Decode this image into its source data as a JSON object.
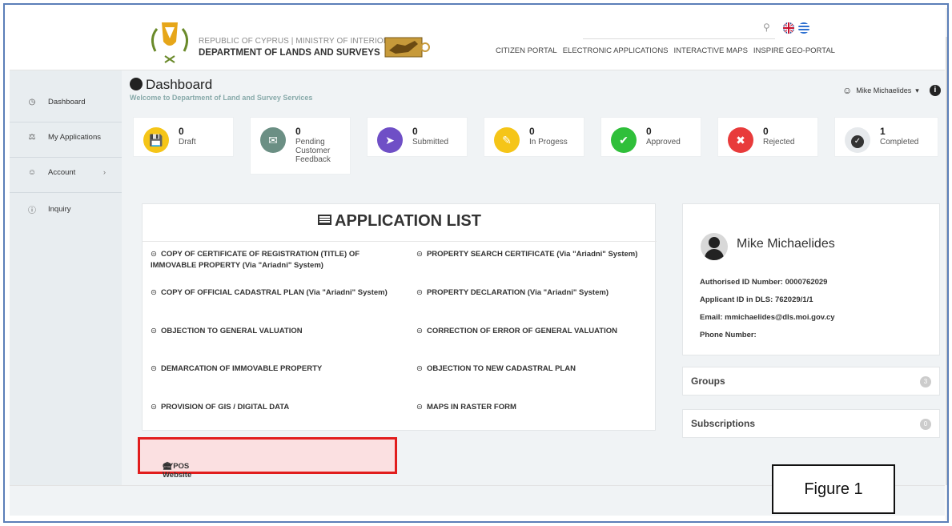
{
  "header": {
    "org_line1": "REPUBLIC OF CYPRUS | MINISTRY OF INTERIOR",
    "org_line2": "DEPARTMENT OF LANDS AND SURVEYS",
    "nav": [
      "CITIZEN PORTAL",
      "ELECTRONIC APPLICATIONS",
      "INTERACTIVE MAPS",
      "INSPIRE GEO-PORTAL"
    ],
    "icons": {
      "search": "search-icon",
      "flag_en": "uk-flag-icon",
      "flag_el": "greece-flag-icon"
    }
  },
  "sidebar": {
    "items": [
      {
        "label": "Dashboard",
        "icon": "clock-icon"
      },
      {
        "label": "My Applications",
        "icon": "bank-icon"
      },
      {
        "label": "Account",
        "icon": "user-icon"
      },
      {
        "label": "Inquiry",
        "icon": "question-icon"
      }
    ]
  },
  "main": {
    "title": "Dashboard",
    "subtitle": "Welcome to Department of Land and Survey Services",
    "user_name": "Mike Michaelides"
  },
  "stats": [
    {
      "count": "0",
      "label": "Draft",
      "color": "#f5c518",
      "icon": "save-icon"
    },
    {
      "count": "0",
      "label": "Pending Customer Feedback",
      "color": "#6b8f84",
      "icon": "chat-icon"
    },
    {
      "count": "0",
      "label": "Submitted",
      "color": "#6f4fc6",
      "icon": "send-icon"
    },
    {
      "count": "0",
      "label": "In Progess",
      "color": "#f5c518",
      "icon": "edit-icon"
    },
    {
      "count": "0",
      "label": "Approved",
      "color": "#2fbf3a",
      "icon": "thumbs-up-icon"
    },
    {
      "count": "0",
      "label": "Rejected",
      "color": "#e83b3b",
      "icon": "thumbs-down-icon"
    },
    {
      "count": "1",
      "label": "Completed",
      "color": "#e6e9ec",
      "icon": "check-icon"
    }
  ],
  "application_list": {
    "title": "APPLICATION LIST",
    "items": [
      "COPY OF CERTIFICATE OF REGISTRATION (TITLE) OF IMMOVABLE PROPERTY (Via \"Ariadni\" System)",
      "PROPERTY SEARCH CERTIFICATE (Via \"Ariadni\" System)",
      "COPY OF OFFICIAL CADASTRAL PLAN (Via \"Ariadni\" System)",
      "PROPERTY DECLARATION (Via \"Ariadni\" System)",
      "OBJECTION TO GENERAL VALUATION",
      "CORRECTION OF ERROR OF GENERAL VALUATION",
      "DEMARCATION OF IMMOVABLE PROPERTY",
      "OBJECTION TO NEW CADASTRAL PLAN",
      "PROVISION OF GIS / DIGITAL DATA",
      "MAPS IN RASTER FORM"
    ]
  },
  "cypos": {
    "label": "CYPOS Website",
    "highlight_color": "#e11d1d"
  },
  "profile": {
    "name": "Mike Michaelides",
    "authorised_id": "Authorised ID Number: 0000762029",
    "applicant_id": "Applicant ID in DLS: 762029/1/1",
    "email": "Email: mmichaelides@dls.moi.gov.cy",
    "phone": "Phone Number:"
  },
  "panels": [
    {
      "title": "Groups",
      "badge": "3"
    },
    {
      "title": "Subscriptions",
      "badge": "0"
    }
  ],
  "figure_label": "Figure 1"
}
